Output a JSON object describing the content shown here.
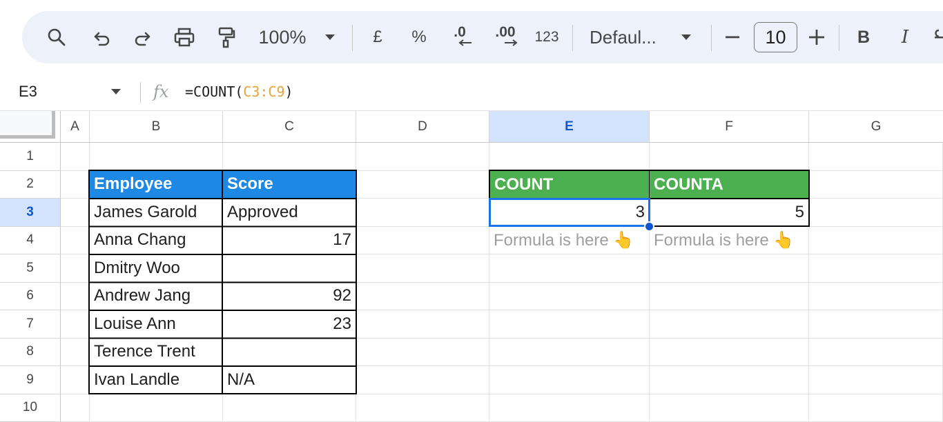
{
  "toolbar": {
    "zoom": "100%",
    "currency_label": "£",
    "percent_label": "%",
    "decrease_decimal_label": ".0",
    "increase_decimal_label": ".00",
    "number_format_label": "123",
    "font_name": "Defaul...",
    "font_size": "10",
    "bold_label": "B",
    "italic_label": "I",
    "icons": [
      "search-icon",
      "undo-icon",
      "redo-icon",
      "print-icon",
      "paint-format-icon",
      "chevron-down-icon",
      "minus-icon",
      "plus-icon"
    ]
  },
  "formula_bar": {
    "cell_ref": "E3",
    "fx_label": "fx",
    "formula_prefix": "=COUNT(",
    "formula_range": "C3:C9",
    "formula_suffix": ")"
  },
  "columns": [
    "A",
    "B",
    "C",
    "D",
    "E",
    "F",
    "G"
  ],
  "rows": [
    "1",
    "2",
    "3",
    "4",
    "5",
    "6",
    "7",
    "8",
    "9",
    "10"
  ],
  "selected": {
    "column": "E",
    "row": "3"
  },
  "table": {
    "headers": [
      "Employee",
      "Score"
    ],
    "employees": [
      "James Garold",
      "Anna Chang",
      "Dmitry Woo",
      "Andrew Jang",
      "Louise Ann",
      "Terence Trent",
      "Ivan Landle"
    ],
    "scores": [
      "Approved",
      "17",
      "",
      "92",
      "23",
      "",
      "N/A"
    ],
    "header_color": "#1e88e5"
  },
  "results": {
    "count_header": "COUNT",
    "counta_header": "COUNTA",
    "count_value": "3",
    "counta_value": "5",
    "count_note": "Formula is here 👆",
    "counta_note": "Formula is here 👆",
    "header_color": "#4caf50"
  },
  "colors": {
    "selection": "#1a73e8",
    "toolbar_bg": "#edf2fa"
  }
}
